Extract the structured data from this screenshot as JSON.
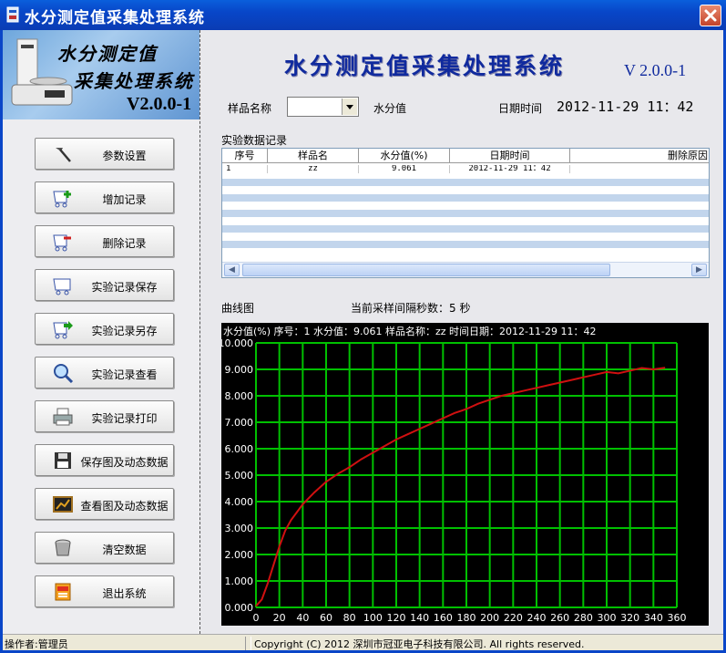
{
  "window": {
    "title": "水分测定值采集处理系统"
  },
  "logo": {
    "line1": "水分测定值",
    "line2": "采集处理系统",
    "version": "V2.0.0-1"
  },
  "header": {
    "title": "水分测定值采集处理系统",
    "version": "V 2.0.0-1"
  },
  "sidebar": {
    "buttons": [
      {
        "label": "参数设置",
        "icon": "hammer-icon"
      },
      {
        "label": "增加记录",
        "icon": "cart-add-icon"
      },
      {
        "label": "删除记录",
        "icon": "cart-remove-icon"
      },
      {
        "label": "实验记录保存",
        "icon": "cart-save-icon"
      },
      {
        "label": "实验记录另存",
        "icon": "cart-arrow-icon"
      },
      {
        "label": "实验记录查看",
        "icon": "magnifier-icon"
      },
      {
        "label": "实验记录打印",
        "icon": "printer-icon"
      },
      {
        "label": "保存图及动态数据",
        "icon": "floppy-icon"
      },
      {
        "label": "查看图及动态数据",
        "icon": "chart-view-icon"
      },
      {
        "label": "清空数据",
        "icon": "bucket-icon"
      },
      {
        "label": "退出系统",
        "icon": "exit-icon"
      }
    ]
  },
  "form": {
    "sample_name_label": "样品名称",
    "sample_name_value": "",
    "moisture_label": "水分值",
    "datetime_label": "日期时间",
    "datetime_value": "2012-11-29   11：42"
  },
  "records": {
    "label": "实验数据记录",
    "columns": [
      "序号",
      "样品名",
      "水分值(%)",
      "日期时间",
      "删除原因"
    ],
    "rows": [
      [
        "1",
        "zz",
        "9.061",
        "2012-11-29   11：42",
        ""
      ]
    ]
  },
  "chart_section": {
    "label": "曲线图",
    "interval_label": "当前采样间隔秒数：5  秒"
  },
  "chart_data": {
    "type": "line",
    "header": "水分值(%)   序号：1   水分值：9.061   样品名称：zz   时间日期：2012-11-29  11：42",
    "xlim": [
      0,
      360
    ],
    "ylim": [
      0,
      10
    ],
    "xticks": [
      "0",
      "20",
      "40",
      "60",
      "80",
      "100",
      "120",
      "140",
      "160",
      "180",
      "200",
      "220",
      "240",
      "260",
      "280",
      "300",
      "320",
      "340",
      "360"
    ],
    "yticks": [
      "0.000",
      "1.000",
      "2.000",
      "3.000",
      "4.000",
      "5.000",
      "6.000",
      "7.000",
      "8.000",
      "9.000",
      "10.000"
    ],
    "grid": true,
    "colors": {
      "background": "#000000",
      "grid": "#00c000",
      "line": "#d01010",
      "text": "#ffffff"
    },
    "series": [
      {
        "x": [
          0,
          5,
          10,
          15,
          20,
          25,
          30,
          35,
          40,
          50,
          60,
          70,
          80,
          90,
          100,
          110,
          120,
          130,
          140,
          150,
          160,
          170,
          180,
          190,
          200,
          210,
          220,
          230,
          240,
          250,
          260,
          270,
          280,
          290,
          300,
          310,
          320,
          330,
          340,
          350
        ],
        "values": [
          0.05,
          0.3,
          0.9,
          1.6,
          2.3,
          2.9,
          3.3,
          3.6,
          3.9,
          4.35,
          4.75,
          5.05,
          5.3,
          5.6,
          5.85,
          6.1,
          6.35,
          6.55,
          6.75,
          6.95,
          7.15,
          7.35,
          7.5,
          7.7,
          7.85,
          8.0,
          8.1,
          8.2,
          8.3,
          8.4,
          8.5,
          8.6,
          8.7,
          8.8,
          8.9,
          8.85,
          8.95,
          9.05,
          9.0,
          9.06
        ]
      }
    ]
  },
  "status": {
    "operator": "操作者:管理员",
    "copyright": "Copyright (C) 2012 深圳市冠亚电子科技有限公司. All rights reserved."
  }
}
